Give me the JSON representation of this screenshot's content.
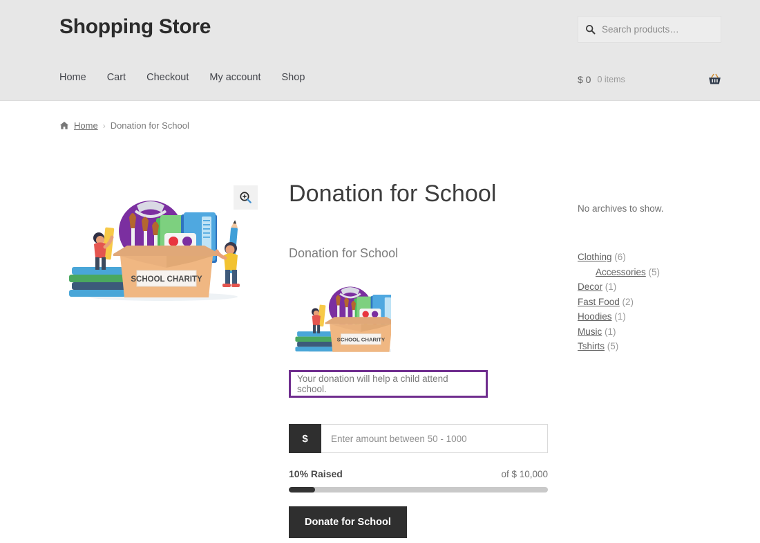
{
  "header": {
    "site_title": "Shopping Store",
    "nav": [
      {
        "label": "Home"
      },
      {
        "label": "Cart"
      },
      {
        "label": "Checkout"
      },
      {
        "label": "My account"
      },
      {
        "label": "Shop"
      }
    ],
    "search": {
      "placeholder": "Search products…",
      "value": "",
      "icon": "search-icon"
    },
    "cart": {
      "amount": "$ 0",
      "items": "0 items",
      "icon": "basket-icon"
    }
  },
  "breadcrumb": {
    "home_icon": "home-icon",
    "home_label": "Home",
    "separator": "›",
    "current": "Donation for School"
  },
  "product": {
    "title": "Donation for School",
    "short_description": "Donation for School",
    "image_alt": "SCHOOL CHARITY",
    "image_caption": "SCHOOL CHARITY",
    "zoom_icon": "zoom-in-icon",
    "donation_note": "Your donation will help a child attend school.",
    "note_border_color": "#6f2d8e",
    "amount_prefix": "$",
    "amount_placeholder": "Enter amount between 50 - 1000",
    "amount_value": "",
    "raised_label": "10% Raised",
    "goal_label": "of $ 10,000",
    "progress_percent": 10,
    "progress_fill_color": "#333333",
    "progress_track_color": "#c9c9c9",
    "donate_button": "Donate for School"
  },
  "sidebar": {
    "archives_note": "No archives to show.",
    "categories": [
      {
        "label": "Clothing",
        "count": "(6)",
        "child": false
      },
      {
        "label": "Accessories",
        "count": "(5)",
        "child": true
      },
      {
        "label": "Decor",
        "count": "(1)",
        "child": false
      },
      {
        "label": "Fast Food",
        "count": "(2)",
        "child": false
      },
      {
        "label": "Hoodies",
        "count": "(1)",
        "child": false
      },
      {
        "label": "Music",
        "count": "(1)",
        "child": false
      },
      {
        "label": "Tshirts",
        "count": "(5)",
        "child": false
      }
    ]
  }
}
